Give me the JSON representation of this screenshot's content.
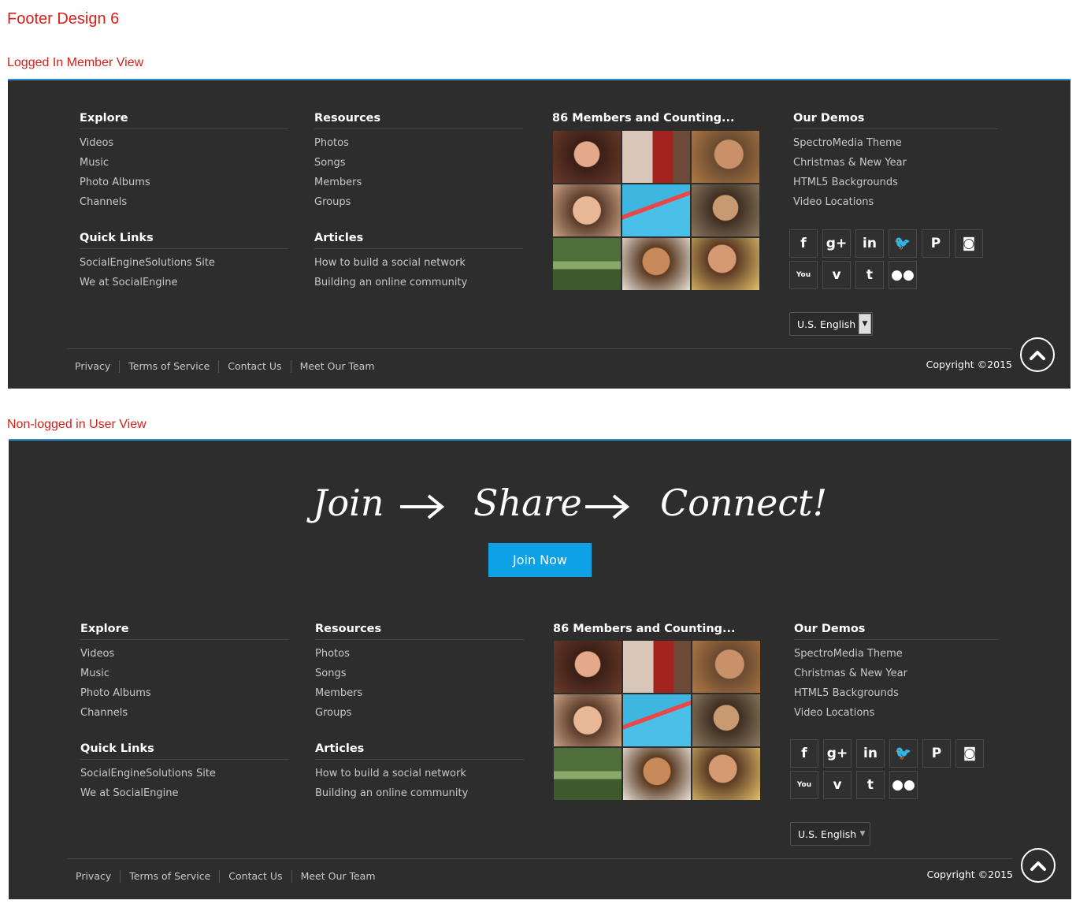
{
  "page_title": "Footer Design 6",
  "views": {
    "logged_in": {
      "label": "Logged In Member View"
    },
    "logged_out": {
      "label": "Non-logged in User View",
      "tagline": [
        "Join",
        "Share",
        "Connect!"
      ],
      "join_button": "Join Now"
    }
  },
  "footer": {
    "explore": {
      "title": "Explore",
      "items": [
        "Videos",
        "Music",
        "Photo Albums",
        "Channels"
      ]
    },
    "quick_links": {
      "title": "Quick Links",
      "items": [
        "SocialEngineSolutions Site",
        "We at SocialEngine"
      ]
    },
    "resources": {
      "title": "Resources",
      "items": [
        "Photos",
        "Songs",
        "Members",
        "Groups"
      ]
    },
    "articles": {
      "title": "Articles",
      "items": [
        "How to build a social network",
        "Building an online community"
      ]
    },
    "members": {
      "title": "86 Members and Counting..."
    },
    "demos": {
      "title": "Our Demos",
      "items": [
        "SpectroMedia Theme",
        "Christmas & New Year",
        "HTML5 Backgrounds",
        "Video Locations"
      ]
    },
    "social": [
      {
        "icon": "facebook-icon",
        "glyph": "f"
      },
      {
        "icon": "google-plus-icon",
        "glyph": "g+"
      },
      {
        "icon": "linkedin-icon",
        "glyph": "in"
      },
      {
        "icon": "twitter-icon",
        "glyph": "🐦"
      },
      {
        "icon": "pinterest-icon",
        "glyph": "P"
      },
      {
        "icon": "instagram-icon",
        "glyph": "◙"
      },
      {
        "icon": "youtube-icon",
        "glyph": "You"
      },
      {
        "icon": "vimeo-icon",
        "glyph": "v"
      },
      {
        "icon": "tumblr-icon",
        "glyph": "t"
      },
      {
        "icon": "flickr-icon",
        "glyph": "●●"
      }
    ],
    "language": "U.S. English",
    "bottom_links": [
      "Privacy",
      "Terms of Service",
      "Contact Us",
      "Meet Our Team"
    ],
    "copyright": "Copyright ©2015"
  },
  "colors": {
    "footer_bg": "#2d2d2d",
    "accent_blue": "#0ea1e6",
    "label_red": "#d6201a"
  }
}
